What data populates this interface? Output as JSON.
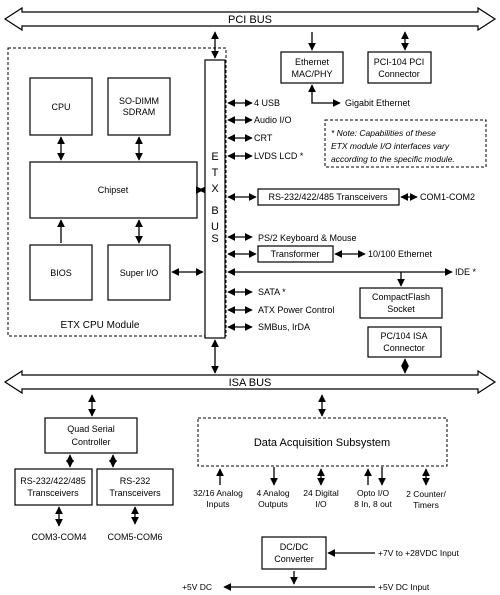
{
  "buses": {
    "pci": "PCI BUS",
    "isa": "ISA BUS",
    "etx": [
      "E",
      "T",
      "X",
      "B",
      "U",
      "S"
    ]
  },
  "cpu_module": {
    "label": "ETX CPU Module",
    "cpu": "CPU",
    "sodimm": [
      "SO-DIMM",
      "SDRAM"
    ],
    "chipset": "Chipset",
    "bios": "BIOS",
    "superio": "Super I/O"
  },
  "ethernet": [
    "Ethernet",
    "MAC/PHY"
  ],
  "pci104": [
    "PCI-104 PCI",
    "Connector"
  ],
  "gigabit": "Gigabit Ethernet",
  "etx_io": {
    "usb": "4 USB",
    "audio": "Audio I/O",
    "crt": "CRT",
    "lvds": "LVDS LCD *",
    "rs232": "RS-232/422/485 Transceivers",
    "com12": "COM1-COM2",
    "ps2": "PS/2 Keyboard & Mouse",
    "transformer": "Transformer",
    "eth100": "10/100 Ethernet",
    "ide": "IDE *",
    "sata": "SATA *",
    "atx": "ATX Power Control",
    "smbus": "SMBus, IrDA"
  },
  "note": [
    "* Note:  Capabilities of these",
    "ETX module I/O interfaces vary",
    "according to the specific module."
  ],
  "compactflash": [
    "CompactFlash",
    "Socket"
  ],
  "pc104isa": [
    "PC/104 ISA",
    "Connector"
  ],
  "quad": [
    "Quad Serial",
    "Controller"
  ],
  "trans1": [
    "RS-232/422/485",
    "Transceivers"
  ],
  "trans2": [
    "RS-232",
    "Transceivers"
  ],
  "com34": "COM3-COM4",
  "com56": "COM5-COM6",
  "daq": {
    "title": "Data Acquisition Subsystem",
    "io": [
      [
        "32/16 Analog",
        "Inputs"
      ],
      [
        "4  Analog",
        "Outputs"
      ],
      [
        "24 Digital",
        "I/O"
      ],
      [
        "Opto  I/O",
        "8 In, 8 out"
      ],
      [
        "2 Counter/",
        "Timers"
      ]
    ]
  },
  "dcdc": [
    "DC/DC",
    "Converter"
  ],
  "power": {
    "in_wide": "+7V to +28VDC Input",
    "out5": "+5V DC",
    "in5": "+5V DC Input"
  }
}
